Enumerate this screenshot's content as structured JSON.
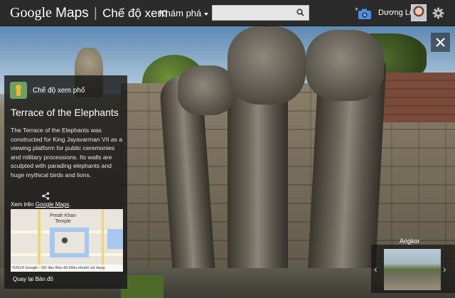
{
  "header": {
    "brand": "Google",
    "product": "Maps",
    "mode": "Chế độ xem",
    "explore": "Khám phá",
    "search_placeholder": "",
    "user_name": "Dương Lê"
  },
  "panel": {
    "badge": "Chế độ xem phố",
    "title": "Terrace of the Elephants",
    "description": "The Terrace of the Elephants was constructed for King Jayavarman VII as a viewing platform for public ceremonies and military processions. Its walls are sculpted with parading elephants and huge mythical birds and lions.",
    "view_on_prefix": "Xem trên ",
    "view_on_link": "Google Maps",
    "view_on_suffix": ".",
    "map_label_line1": "Preah Khan",
    "map_label_line2": "Temple",
    "map_footer": "©2014 Google - Dữ liệu Bản đồ   Điều khoản sử dụng",
    "back": "Quay lại Bản đồ"
  },
  "thumbnail": {
    "label": "Angkor"
  },
  "icons": {
    "search": "search-icon",
    "camera": "camera-icon",
    "settings": "gear-icon",
    "close": "close-icon",
    "share": "share-icon",
    "prev": "chevron-left-icon",
    "next": "chevron-right-icon"
  },
  "colors": {
    "topbar": "#2b2b2b",
    "camera_blue": "#4a8fe7",
    "pegman_green": "#6ba35c"
  }
}
